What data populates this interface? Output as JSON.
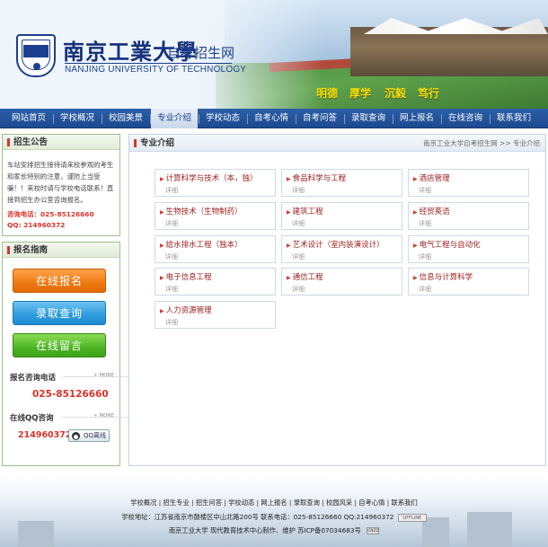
{
  "header": {
    "logo_cn": "南京工業大學",
    "logo_sub": "自考招生网",
    "logo_en": "NANJING UNIVERSITY OF TECHNOLOGY",
    "motto": [
      "明德",
      "厚学",
      "沉毅",
      "笃行"
    ]
  },
  "nav": {
    "items": [
      "网站首页",
      "学校概况",
      "校园美景",
      "专业介绍",
      "学校动态",
      "自考心情",
      "自考问答",
      "录取查询",
      "网上报名",
      "在线咨询",
      "联系我们"
    ],
    "active_index": 3
  },
  "notice": {
    "title": "招生公告",
    "text": "车站安排招生接待请来校参观的考生和家长特别的注意，谨防上当受骗！！来校时请与学校电话联系！直接到招生办公室咨询报名。",
    "phone": "咨询电话：025-85126660",
    "qq": "QQ: 214960372"
  },
  "guide": {
    "title": "报名指南",
    "btn_register": "在线报名",
    "btn_query": "录取查询",
    "btn_message": "在线留言",
    "phone_label": "报名咨询电话",
    "phone_value": "025-85126660",
    "qq_label": "在线QQ咨询",
    "qq_value": "214960372",
    "qq_status": "QQ离线",
    "more": "+ MORE"
  },
  "main": {
    "title": "专业介绍",
    "breadcrumb": "南京工业大学自考招生网 >> 专业介绍",
    "detail_label": "详细",
    "majors": [
      "计算科学与技术（本，独）",
      "食品科学与工程",
      "酒店管理",
      "生物技术（生物制药）",
      "建筑工程",
      "经贸英语",
      "给水排水工程（独本）",
      "艺术设计（室内装潢设计）",
      "电气工程与自动化",
      "电子信息工程",
      "通信工程",
      "信息与计算科学",
      "人力资源管理"
    ]
  },
  "footer": {
    "links": "学校概况 | 招生专业 | 招生问答 | 学校动态 | 网上报名 | 录取查询 | 校园风采 | 自考心情 | 联系我们",
    "address": "学校地址：江苏省南京市鼓楼区中山北路200号 联系电话：025-85126660 QQ:214960372",
    "offline": "OFFLINE",
    "copyright": "南京工业大学 现代教育技术中心制作、维护 苏ICP备07034683号",
    "cnzz": "CNZZ"
  },
  "colors": {
    "nav_blue": "#1d4a8f",
    "accent_red": "#d9342b",
    "motto_yellow": "#f5e400"
  }
}
